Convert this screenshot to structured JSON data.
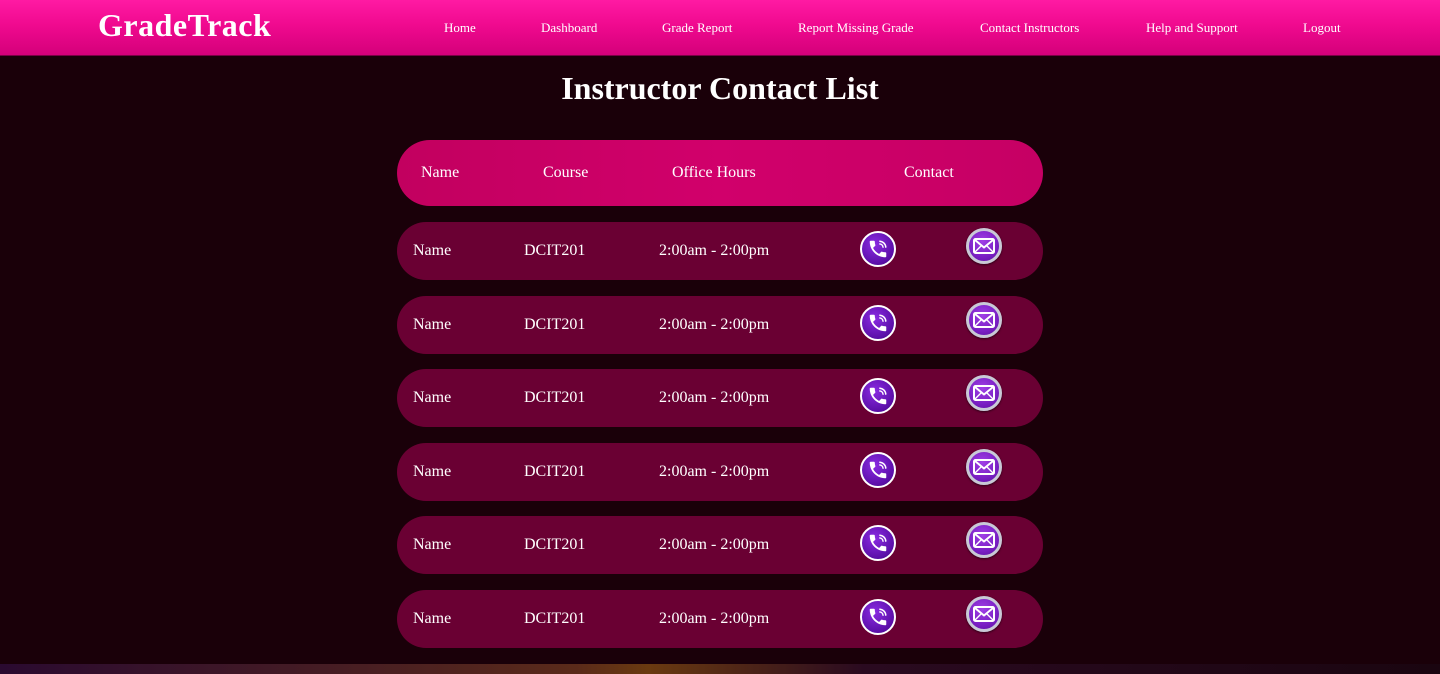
{
  "app": {
    "logo": "GradeTrack"
  },
  "nav": {
    "items": [
      {
        "label": "Home"
      },
      {
        "label": "Dashboard"
      },
      {
        "label": "Grade Report"
      },
      {
        "label": "Report Missing Grade"
      },
      {
        "label": "Contact Instructors"
      },
      {
        "label": "Help and Support"
      },
      {
        "label": "Logout"
      }
    ]
  },
  "page": {
    "title": "Instructor Contact List"
  },
  "table": {
    "headers": {
      "name": "Name",
      "course": "Course",
      "office_hours": "Office Hours",
      "contact": "Contact"
    },
    "rows": [
      {
        "name": "Name",
        "course": "DCIT201",
        "office_hours": "2:00am - 2:00pm"
      },
      {
        "name": "Name",
        "course": "DCIT201",
        "office_hours": "2:00am - 2:00pm"
      },
      {
        "name": "Name",
        "course": "DCIT201",
        "office_hours": "2:00am - 2:00pm"
      },
      {
        "name": "Name",
        "course": "DCIT201",
        "office_hours": "2:00am - 2:00pm"
      },
      {
        "name": "Name",
        "course": "DCIT201",
        "office_hours": "2:00am - 2:00pm"
      },
      {
        "name": "Name",
        "course": "DCIT201",
        "office_hours": "2:00am - 2:00pm"
      }
    ]
  },
  "colors": {
    "navbar": "#f00a8f",
    "background": "#1a0009",
    "header_row": "#c8005f",
    "data_row": "#6a0033",
    "icon_purple": "#5b0fa8"
  },
  "icons": {
    "call": "phone-call-icon",
    "email": "envelope-icon"
  }
}
